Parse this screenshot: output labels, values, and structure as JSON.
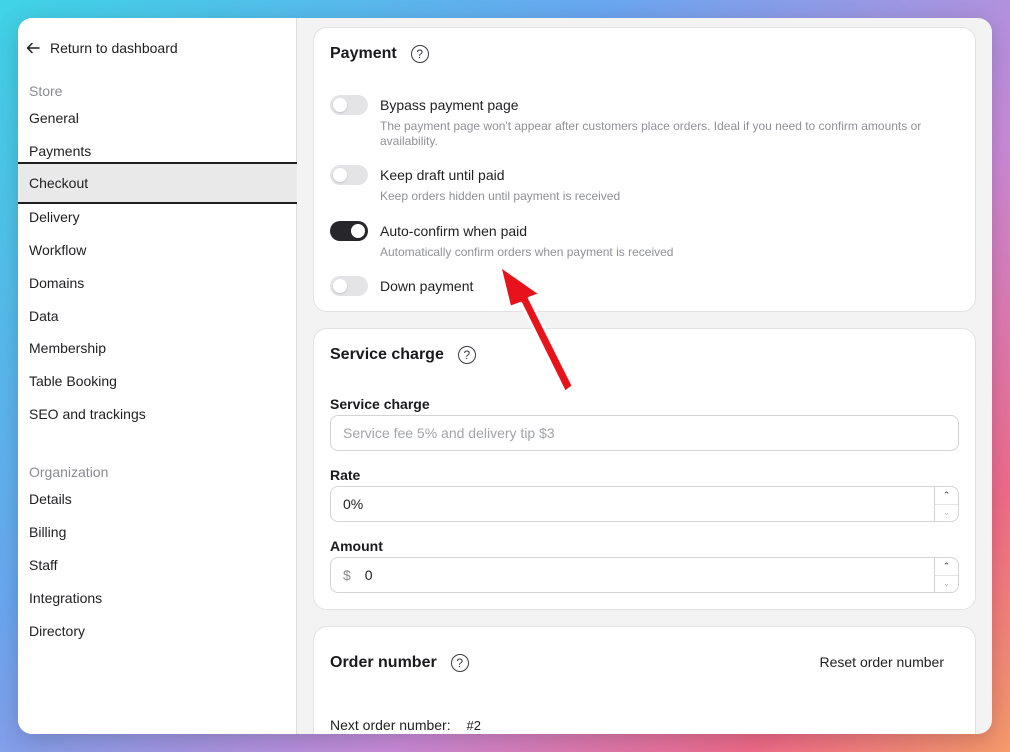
{
  "sidebar": {
    "back_label": "Return to dashboard",
    "store_label": "Store",
    "store_items": [
      "General",
      "Payments",
      "Checkout",
      "Delivery",
      "Workflow",
      "Domains",
      "Data",
      "Membership",
      "Table Booking",
      "SEO and trackings"
    ],
    "active_item": "Checkout",
    "org_label": "Organization",
    "org_items": [
      "Details",
      "Billing",
      "Staff",
      "Integrations",
      "Directory"
    ]
  },
  "payment": {
    "title": "Payment",
    "help_icon": "?",
    "options": [
      {
        "label": "Bypass payment page",
        "desc": "The payment page won't appear after customers place orders. Ideal if you need to confirm amounts or availability.",
        "enabled": false
      },
      {
        "label": "Keep draft until paid",
        "desc": "Keep orders hidden until payment is received",
        "enabled": false
      },
      {
        "label": "Auto-confirm when paid",
        "desc": "Automatically confirm orders when payment is received",
        "enabled": true
      },
      {
        "label": "Down payment",
        "desc": "",
        "enabled": false
      }
    ]
  },
  "service_charge": {
    "title": "Service charge",
    "help_icon": "?",
    "name_label": "Service charge",
    "name_placeholder": "Service fee 5% and delivery tip $3",
    "rate_label": "Rate",
    "rate_value": "0%",
    "amount_label": "Amount",
    "amount_prefix": "$",
    "amount_value": "0",
    "step_up": "⌃",
    "step_down": "⌄"
  },
  "order_number": {
    "title": "Order number",
    "help_icon": "?",
    "reset_label": "Reset order number",
    "next_label": "Next order number:",
    "next_value": "#2"
  },
  "colors": {
    "annotation_arrow": "#e8121b",
    "toggle_on": "#26262b",
    "toggle_off": "#e4e4e6"
  },
  "icons": {
    "back": "arrow-left-icon",
    "help": "question-circle-icon",
    "annotation": "red-arrow-icon"
  }
}
